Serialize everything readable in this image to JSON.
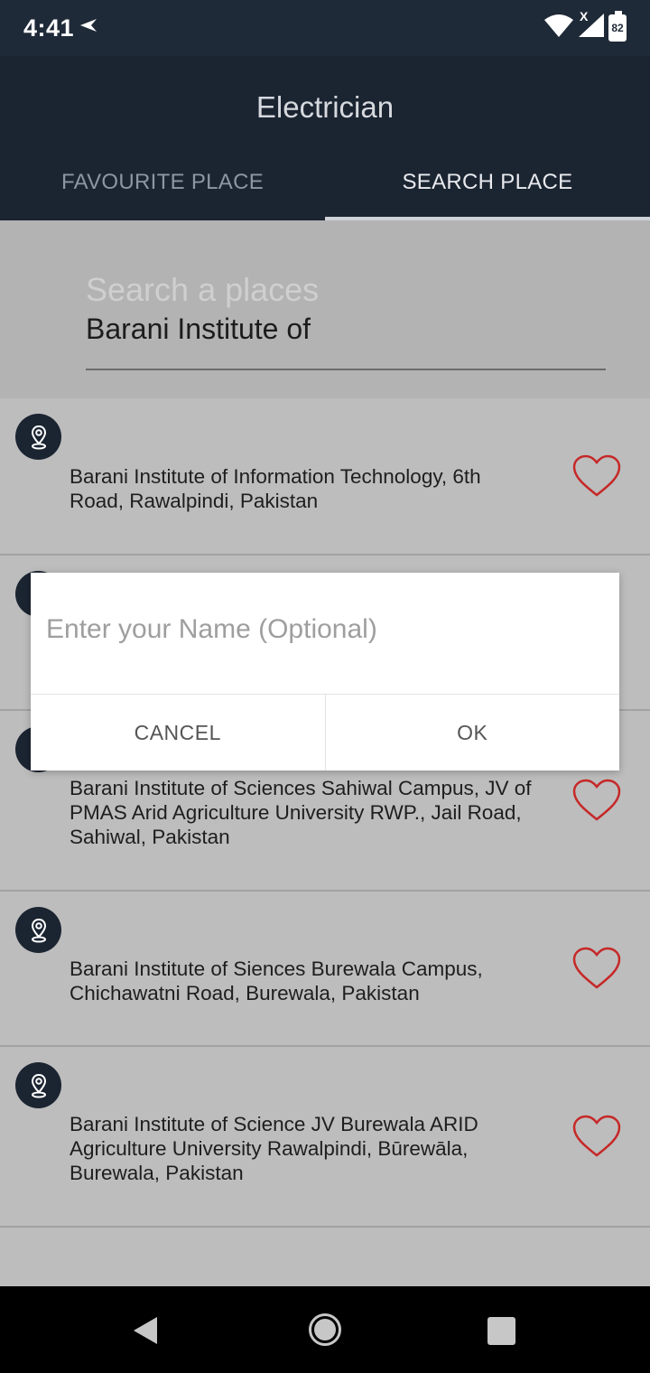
{
  "status": {
    "time": "4:41",
    "battery": "82",
    "signal_badge": "X"
  },
  "app": {
    "title": "Electrician"
  },
  "tabs": [
    {
      "label": "FAVOURITE PLACE"
    },
    {
      "label": "SEARCH PLACE"
    }
  ],
  "search": {
    "hint": "Search a places",
    "value": "Barani Institute of"
  },
  "results": [
    {
      "address": "Barani Institute of Information Technology, 6th Road, Rawalpindi, Pakistan"
    },
    {
      "address": "Barani Institute of Sciences Sahiwal Campus, JV of PMAS Arid Agriculture University RWP., Jail Road, Sahiwal, Pakistan"
    },
    {
      "address": "Barani Institute of Siences Burewala Campus, Chichawatni Road, Burewala, Pakistan"
    },
    {
      "address": "Barani Institute of Science JV Burewala ARID Agriculture University Rawalpindi, Būrewāla, Burewala, Pakistan"
    }
  ],
  "dialog": {
    "placeholder": "Enter your Name (Optional)",
    "cancel_label": "CANCEL",
    "ok_label": "OK"
  },
  "icons": {
    "pin": "location-pin-icon",
    "heart": "heart-outline-icon",
    "back": "back-icon",
    "home": "home-icon",
    "recent": "recent-apps-icon"
  },
  "colors": {
    "app_bar": "#1b2431",
    "heart": "#c62828",
    "overlay": "#bdbdbd"
  }
}
